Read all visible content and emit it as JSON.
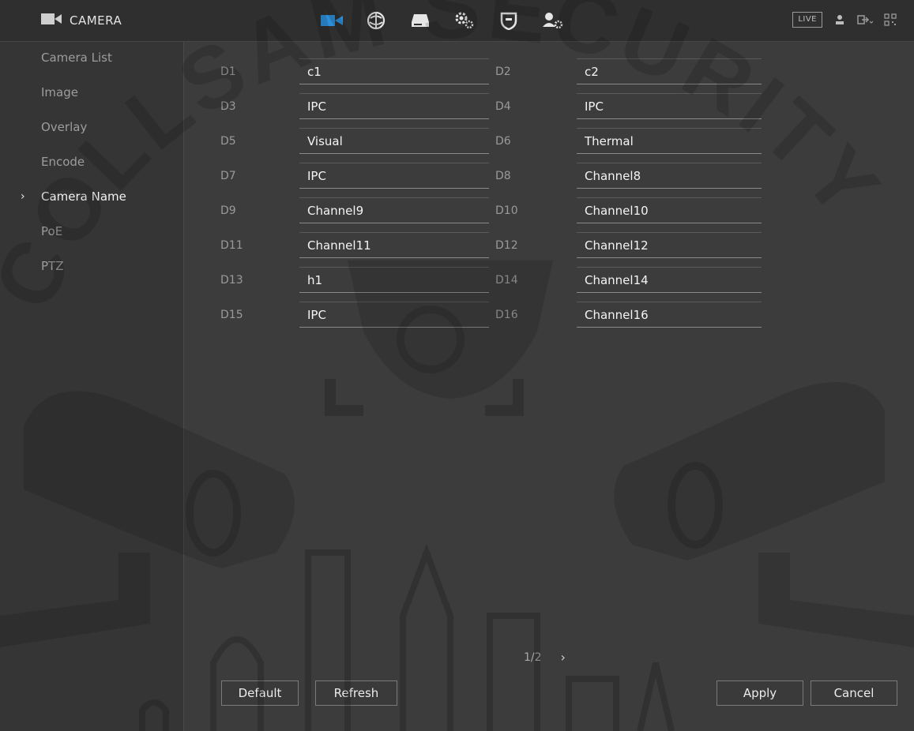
{
  "header": {
    "title": "CAMERA",
    "live_label": "LIVE",
    "icons": [
      "camera-icon",
      "network-icon",
      "storage-icon",
      "system-icon",
      "security-icon",
      "account-icon"
    ]
  },
  "sidebar": {
    "items": [
      {
        "label": "Camera List",
        "active": false
      },
      {
        "label": "Image",
        "active": false
      },
      {
        "label": "Overlay",
        "active": false
      },
      {
        "label": "Encode",
        "active": false
      },
      {
        "label": "Camera Name",
        "active": true
      },
      {
        "label": "PoE",
        "active": false
      },
      {
        "label": "PTZ",
        "active": false
      }
    ]
  },
  "channels": [
    {
      "id": "D1",
      "name": "c1"
    },
    {
      "id": "D2",
      "name": "c2"
    },
    {
      "id": "D3",
      "name": "IPC"
    },
    {
      "id": "D4",
      "name": "IPC"
    },
    {
      "id": "D5",
      "name": "Visual"
    },
    {
      "id": "D6",
      "name": "Thermal"
    },
    {
      "id": "D7",
      "name": "IPC"
    },
    {
      "id": "D8",
      "name": "Channel8"
    },
    {
      "id": "D9",
      "name": "Channel9"
    },
    {
      "id": "D10",
      "name": "Channel10"
    },
    {
      "id": "D11",
      "name": "Channel11"
    },
    {
      "id": "D12",
      "name": "Channel12"
    },
    {
      "id": "D13",
      "name": "h1"
    },
    {
      "id": "D14",
      "name": "Channel14"
    },
    {
      "id": "D15",
      "name": "IPC"
    },
    {
      "id": "D16",
      "name": "Channel16"
    }
  ],
  "pager": {
    "current": "1/2",
    "next": "›"
  },
  "buttons": {
    "default": "Default",
    "refresh": "Refresh",
    "apply": "Apply",
    "cancel": "Cancel"
  },
  "watermark": {
    "text": "COLLSAM SECURITY"
  }
}
